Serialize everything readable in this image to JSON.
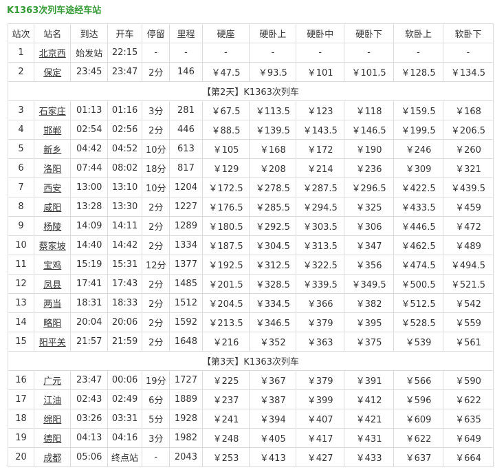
{
  "title": "K1363次列车途经车站",
  "headers": [
    "站次",
    "站名",
    "到达",
    "开车",
    "停留",
    "里程",
    "硬座",
    "硬卧上",
    "硬卧中",
    "硬卧下",
    "软卧上",
    "软卧下"
  ],
  "sections": [
    {
      "day_label": "",
      "rows": [
        [
          "1",
          "北京西",
          "始发站",
          "22:15",
          "-",
          "-",
          "-",
          "-",
          "-",
          "-",
          "-",
          "-"
        ],
        [
          "2",
          "保定",
          "23:45",
          "23:47",
          "2分",
          "146",
          "￥47.5",
          "￥93.5",
          "￥101",
          "￥101.5",
          "￥128.5",
          "￥134.5"
        ]
      ]
    },
    {
      "day_label": "【第2天】K1363次列车",
      "rows": [
        [
          "3",
          "石家庄",
          "01:13",
          "01:16",
          "3分",
          "281",
          "￥67.5",
          "￥113.5",
          "￥123",
          "￥118",
          "￥159.5",
          "￥168"
        ],
        [
          "4",
          "邯郸",
          "02:54",
          "02:56",
          "2分",
          "446",
          "￥88.5",
          "￥139.5",
          "￥143.5",
          "￥146.5",
          "￥199.5",
          "￥206.5"
        ],
        [
          "5",
          "新乡",
          "04:42",
          "04:52",
          "10分",
          "613",
          "￥105",
          "￥168",
          "￥172",
          "￥190",
          "￥246",
          "￥260"
        ],
        [
          "6",
          "洛阳",
          "07:44",
          "08:02",
          "18分",
          "817",
          "￥129",
          "￥208",
          "￥214",
          "￥236",
          "￥309",
          "￥321"
        ],
        [
          "7",
          "西安",
          "13:00",
          "13:10",
          "10分",
          "1204",
          "￥172.5",
          "￥278.5",
          "￥287.5",
          "￥296.5",
          "￥422.5",
          "￥439.5"
        ],
        [
          "8",
          "咸阳",
          "13:28",
          "13:30",
          "2分",
          "1227",
          "￥176.5",
          "￥285.5",
          "￥294.5",
          "￥325",
          "￥433.5",
          "￥459"
        ],
        [
          "9",
          "杨陵",
          "14:09",
          "14:11",
          "2分",
          "1289",
          "￥180.5",
          "￥292.5",
          "￥303.5",
          "￥306",
          "￥446.5",
          "￥472"
        ],
        [
          "10",
          "蔡家坡",
          "14:40",
          "14:42",
          "2分",
          "1334",
          "￥187.5",
          "￥304.5",
          "￥313.5",
          "￥347",
          "￥462.5",
          "￥489"
        ],
        [
          "11",
          "宝鸡",
          "15:19",
          "15:31",
          "12分",
          "1377",
          "￥192.5",
          "￥312.5",
          "￥322.5",
          "￥356",
          "￥474.5",
          "￥494.5"
        ],
        [
          "12",
          "凤县",
          "17:41",
          "17:43",
          "2分",
          "1485",
          "￥201.5",
          "￥328.5",
          "￥339.5",
          "￥349.5",
          "￥500.5",
          "￥521.5"
        ],
        [
          "13",
          "两当",
          "18:31",
          "18:33",
          "2分",
          "1512",
          "￥204.5",
          "￥334.5",
          "￥366",
          "￥382",
          "￥512.5",
          "￥542"
        ],
        [
          "14",
          "略阳",
          "20:04",
          "20:06",
          "2分",
          "1592",
          "￥213.5",
          "￥346.5",
          "￥379",
          "￥395",
          "￥528.5",
          "￥559"
        ],
        [
          "15",
          "阳平关",
          "21:57",
          "21:59",
          "2分",
          "1648",
          "￥216",
          "￥352",
          "￥363",
          "￥375",
          "￥539",
          "￥561"
        ]
      ]
    },
    {
      "day_label": "【第3天】K1363次列车",
      "rows": [
        [
          "16",
          "广元",
          "23:47",
          "00:06",
          "19分",
          "1727",
          "￥225",
          "￥367",
          "￥379",
          "￥391",
          "￥566",
          "￥590"
        ],
        [
          "17",
          "江油",
          "02:43",
          "02:49",
          "6分",
          "1889",
          "￥237",
          "￥387",
          "￥399",
          "￥412",
          "￥596",
          "￥622"
        ],
        [
          "18",
          "绵阳",
          "03:26",
          "03:31",
          "5分",
          "1928",
          "￥241",
          "￥394",
          "￥407",
          "￥421",
          "￥609",
          "￥635"
        ],
        [
          "19",
          "德阳",
          "04:13",
          "04:16",
          "3分",
          "1982",
          "￥248",
          "￥405",
          "￥417",
          "￥431",
          "￥622",
          "￥649"
        ],
        [
          "20",
          "成都",
          "05:06",
          "终点站",
          "-",
          "2043",
          "￥253",
          "￥413",
          "￥427",
          "￥433",
          "￥637",
          "￥664"
        ]
      ]
    }
  ]
}
